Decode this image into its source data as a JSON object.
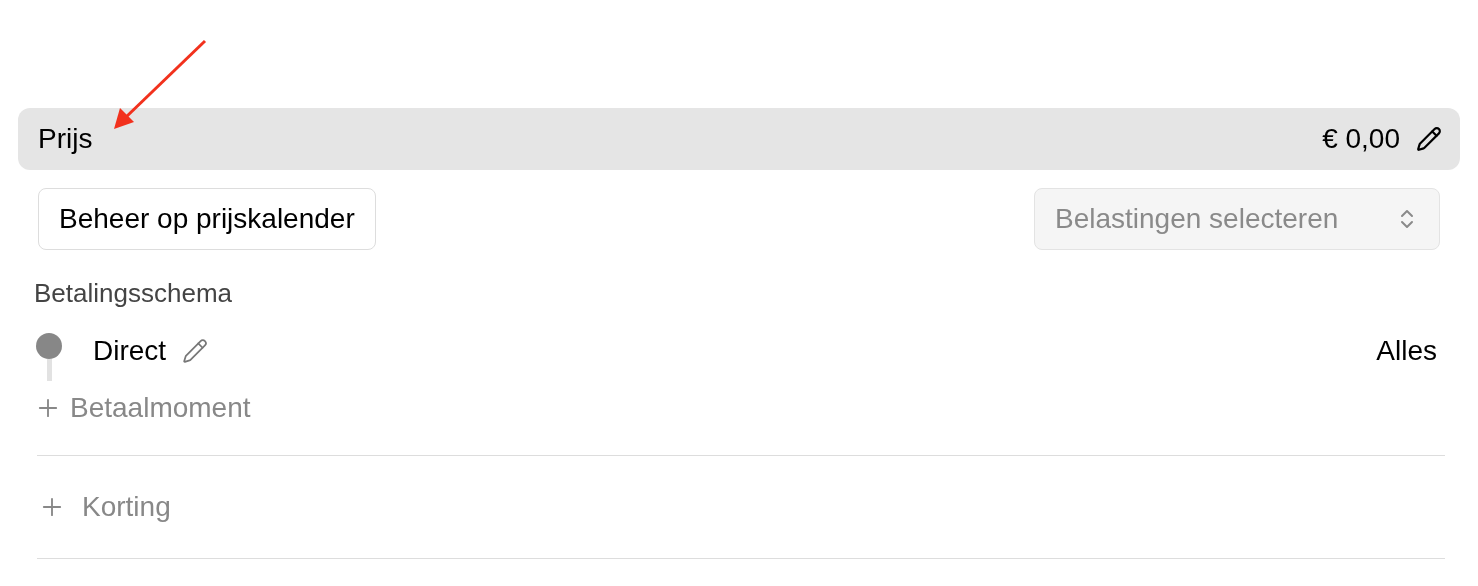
{
  "price": {
    "label": "Prijs",
    "amount": "€ 0,00"
  },
  "calendar_button": "Beheer op prijskalender",
  "tax_select": {
    "placeholder": "Belastingen selecteren"
  },
  "payment_schedule": {
    "title": "Betalingsschema",
    "moments": [
      {
        "name": "Direct",
        "amount": "Alles"
      }
    ],
    "add_label": "Betaalmoment"
  },
  "discount": {
    "add_label": "Korting"
  }
}
